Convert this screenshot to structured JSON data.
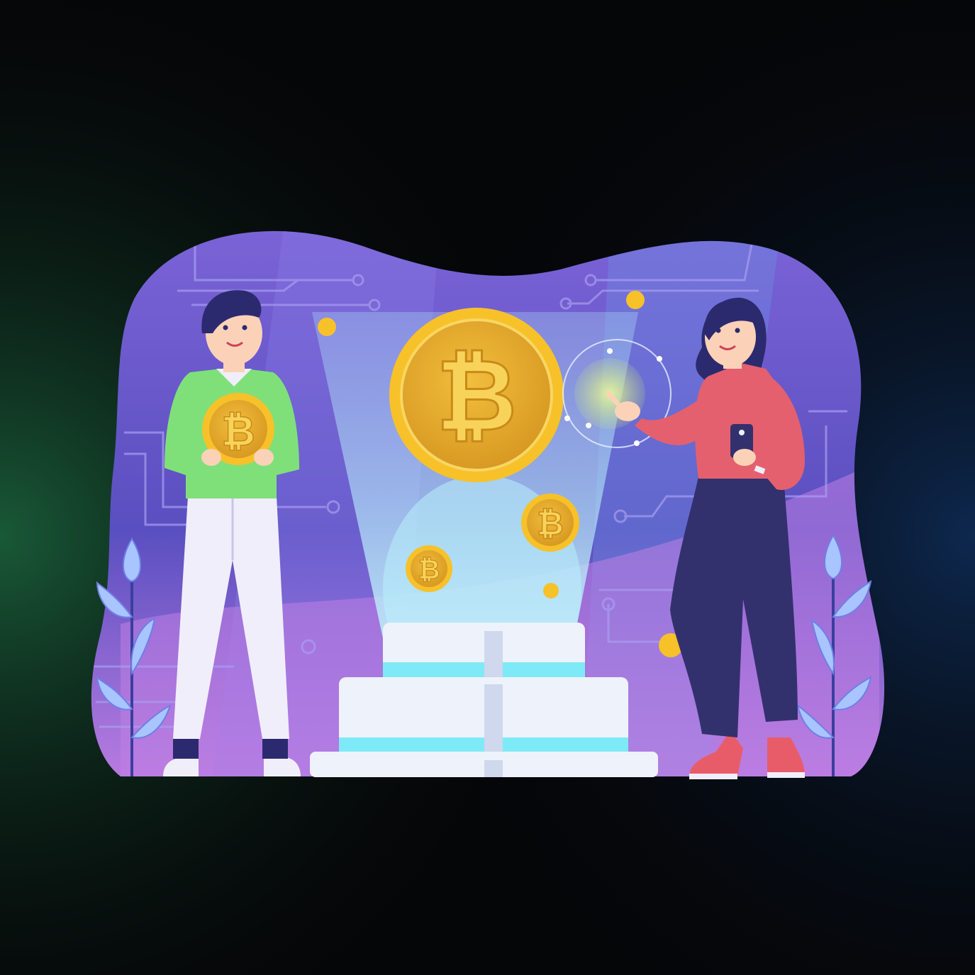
{
  "scene": {
    "background_colors": {
      "left_glow": "#1a5e3a",
      "right_glow": "#0e2a52",
      "base": "#050608"
    },
    "blob_colors": {
      "top": "#7a63d6",
      "mid": "#5a4fc0",
      "bottom": "#b77be0"
    },
    "coin_symbol": "₿",
    "coin_colors": {
      "rim": "#f7c12a",
      "face": "#e2a92a",
      "symbol": "#f8d35a"
    },
    "man_colors": {
      "sweater": "#7fe07a",
      "pants": "#f0eefb",
      "hair": "#2c2a6e"
    },
    "woman_colors": {
      "top": "#e4606e",
      "pants": "#33306e",
      "hair": "#2c2a6e",
      "shoes": "#e85c6a"
    },
    "pedestal_colors": {
      "face": "#eef2fb",
      "glow": "#7eeaf7"
    },
    "icons": [
      "bitcoin-coin",
      "smartphone",
      "hologram-touch",
      "leaf-plant",
      "circuit-lines"
    ]
  }
}
